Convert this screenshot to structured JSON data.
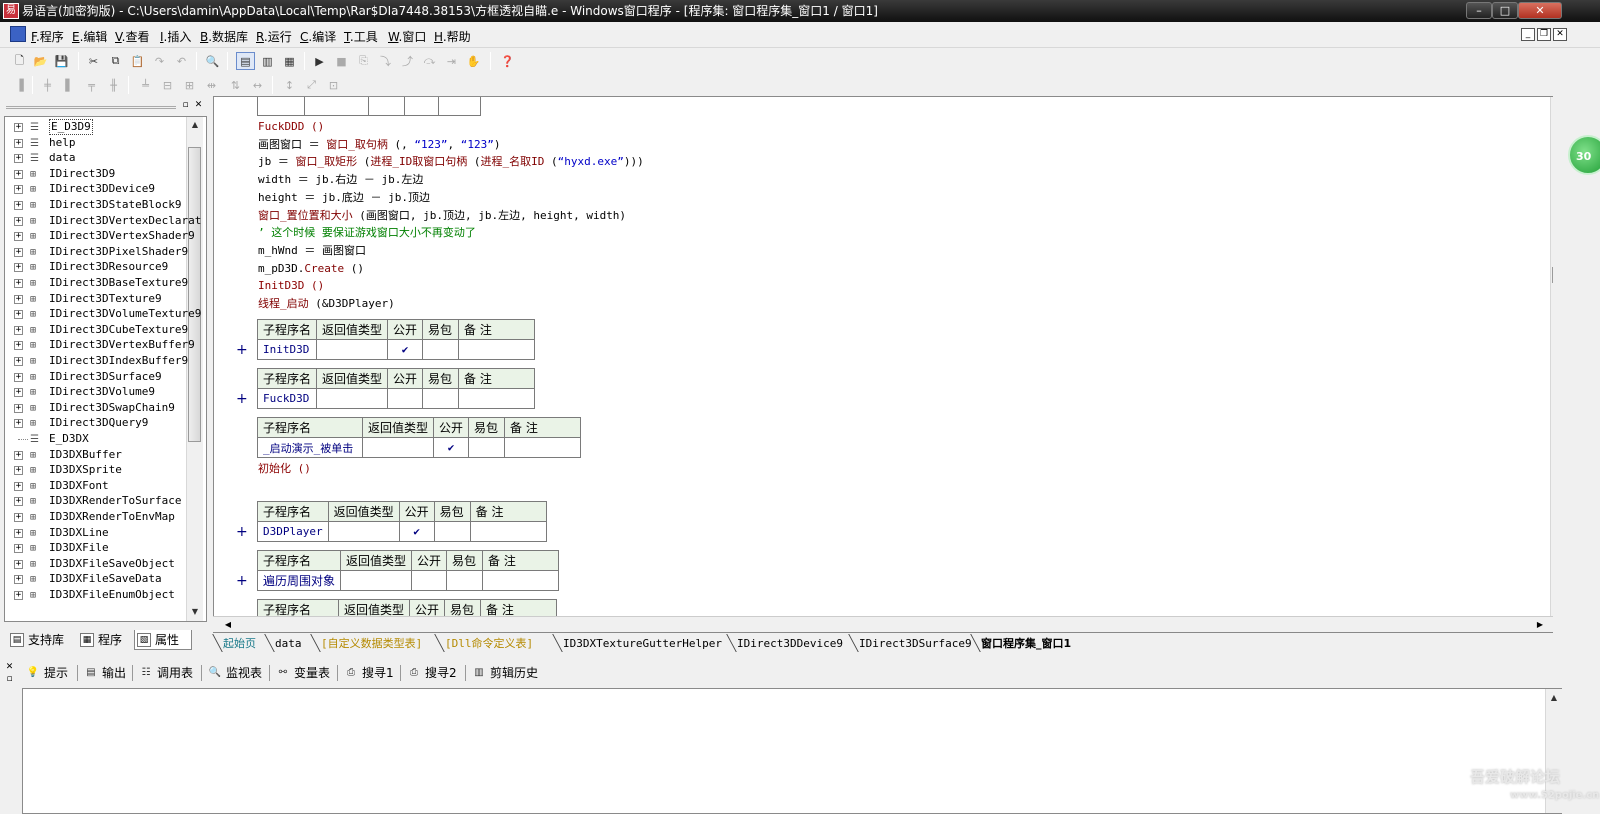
{
  "window": {
    "title": "易语言(加密狗版) - C:\\Users\\damin\\AppData\\Local\\Temp\\Rar$DIa7448.38153\\方框透视自瞄.e - Windows窗口程序 - [程序集: 窗口程序集_窗口1 / 窗口1]",
    "controls": {
      "minimize": "–",
      "maximize": "□",
      "close": "✕"
    }
  },
  "menubar": {
    "items": [
      {
        "key": "F",
        "label": ".程序"
      },
      {
        "key": "E",
        "label": ".编辑"
      },
      {
        "key": "V",
        "label": ".查看"
      },
      {
        "key": "I",
        "label": ".插入"
      },
      {
        "key": "B",
        "label": ".数据库"
      },
      {
        "key": "R",
        "label": ".运行"
      },
      {
        "key": "C",
        "label": ".编译"
      },
      {
        "key": "T",
        "label": ".工具"
      },
      {
        "key": "W",
        "label": ".窗口"
      },
      {
        "key": "H",
        "label": ".帮助"
      }
    ],
    "mdi": {
      "minimize": "_",
      "restore": "❐",
      "close": "✕"
    }
  },
  "toolbar1": {
    "icons": [
      "new-file-icon",
      "open-icon",
      "save-icon",
      "cut-icon",
      "copy-icon",
      "paste-icon",
      "redo-icon",
      "undo-icon",
      "find-icon",
      "layout-1-icon",
      "layout-2-icon",
      "layout-3-icon",
      "run-icon",
      "stop-icon",
      "step-icon",
      "step-into-icon",
      "step-out-icon",
      "step-over-icon",
      "run-to-cursor-icon",
      "hand-icon",
      "help-icon"
    ]
  },
  "toolbar2": {
    "icons": [
      "align-left-icon",
      "align-center-icon",
      "align-right-icon",
      "align-top-icon",
      "align-middle-icon",
      "align-bottom-icon",
      "center-h-icon",
      "center-v-icon",
      "space-h-icon",
      "space-v-icon",
      "same-width-icon",
      "same-height-icon",
      "same-size-icon"
    ]
  },
  "left_panel": {
    "tree": [
      {
        "label": "E_D3D9",
        "icon": "library-icon",
        "expander": "+",
        "selected": true
      },
      {
        "label": "help",
        "icon": "library-icon",
        "expander": "+"
      },
      {
        "label": "data",
        "icon": "library-icon",
        "expander": "+"
      },
      {
        "label": "IDirect3D9",
        "icon": "class-icon",
        "expander": "+"
      },
      {
        "label": "IDirect3DDevice9",
        "icon": "class-icon",
        "expander": "+"
      },
      {
        "label": "IDirect3DStateBlock9",
        "icon": "class-icon",
        "expander": "+"
      },
      {
        "label": "IDirect3DVertexDeclarat",
        "icon": "class-icon",
        "expander": "+"
      },
      {
        "label": "IDirect3DVertexShader9",
        "icon": "class-icon",
        "expander": "+"
      },
      {
        "label": "IDirect3DPixelShader9",
        "icon": "class-icon",
        "expander": "+"
      },
      {
        "label": "IDirect3DResource9",
        "icon": "class-icon",
        "expander": "+"
      },
      {
        "label": "IDirect3DBaseTexture9",
        "icon": "class-icon",
        "expander": "+"
      },
      {
        "label": "IDirect3DTexture9",
        "icon": "class-icon",
        "expander": "+"
      },
      {
        "label": "IDirect3DVolumeTexture9",
        "icon": "class-icon",
        "expander": "+"
      },
      {
        "label": "IDirect3DCubeTexture9",
        "icon": "class-icon",
        "expander": "+"
      },
      {
        "label": "IDirect3DVertexBuffer9",
        "icon": "class-icon",
        "expander": "+"
      },
      {
        "label": "IDirect3DIndexBuffer9",
        "icon": "class-icon",
        "expander": "+"
      },
      {
        "label": "IDirect3DSurface9",
        "icon": "class-icon",
        "expander": "+"
      },
      {
        "label": "IDirect3DVolume9",
        "icon": "class-icon",
        "expander": "+"
      },
      {
        "label": "IDirect3DSwapChain9",
        "icon": "class-icon",
        "expander": "+"
      },
      {
        "label": "IDirect3DQuery9",
        "icon": "class-icon",
        "expander": "+"
      },
      {
        "label": "E_D3DX",
        "icon": "library-icon",
        "expander": ""
      },
      {
        "label": "ID3DXBuffer",
        "icon": "class-icon",
        "expander": "+"
      },
      {
        "label": "ID3DXSprite",
        "icon": "class-icon",
        "expander": "+"
      },
      {
        "label": "ID3DXFont",
        "icon": "class-icon",
        "expander": "+"
      },
      {
        "label": "ID3DXRenderToSurface",
        "icon": "class-icon",
        "expander": "+"
      },
      {
        "label": "ID3DXRenderToEnvMap",
        "icon": "class-icon",
        "expander": "+"
      },
      {
        "label": "ID3DXLine",
        "icon": "class-icon",
        "expander": "+"
      },
      {
        "label": "ID3DXFile",
        "icon": "class-icon",
        "expander": "+"
      },
      {
        "label": "ID3DXFileSaveObject",
        "icon": "class-icon",
        "expander": "+"
      },
      {
        "label": "ID3DXFileSaveData",
        "icon": "class-icon",
        "expander": "+"
      },
      {
        "label": "ID3DXFileEnumObject",
        "icon": "class-icon",
        "expander": "+"
      }
    ],
    "tabs": [
      {
        "label": "支持库",
        "icon": "library-tab-icon",
        "active": false
      },
      {
        "label": "程序",
        "icon": "program-tab-icon",
        "active": false
      },
      {
        "label": "属性",
        "icon": "property-tab-icon",
        "active": true
      }
    ]
  },
  "editor": {
    "code_lines": [
      {
        "row": 0,
        "parts": [
          {
            "t": "FuckDDD ()",
            "c": "c-red"
          }
        ]
      },
      {
        "row": 1,
        "parts": [
          {
            "t": "画图窗口 ＝ ",
            "c": "c-blk"
          },
          {
            "t": "窗口_取句柄",
            "c": "c-call"
          },
          {
            "t": " (, ",
            "c": "c-blk"
          },
          {
            "t": "“123”",
            "c": "c-str"
          },
          {
            "t": ", ",
            "c": "c-blk"
          },
          {
            "t": "“123”",
            "c": "c-str"
          },
          {
            "t": ")",
            "c": "c-blk"
          }
        ]
      },
      {
        "row": 2,
        "parts": [
          {
            "t": "jb ＝ ",
            "c": "c-blk"
          },
          {
            "t": "窗口_取矩形",
            "c": "c-call"
          },
          {
            "t": " (",
            "c": "c-blk"
          },
          {
            "t": "进程_ID取窗口句柄",
            "c": "c-call"
          },
          {
            "t": " (",
            "c": "c-blk"
          },
          {
            "t": "进程_名取ID",
            "c": "c-call"
          },
          {
            "t": " (",
            "c": "c-blk"
          },
          {
            "t": "“hyxd.exe”",
            "c": "c-str"
          },
          {
            "t": ")))",
            "c": "c-blk"
          }
        ]
      },
      {
        "row": 3,
        "parts": [
          {
            "t": "width ＝ jb.右边 － jb.左边",
            "c": "c-blk"
          }
        ]
      },
      {
        "row": 4,
        "parts": [
          {
            "t": "height ＝ jb.底边 － jb.顶边",
            "c": "c-blk"
          }
        ]
      },
      {
        "row": 5,
        "parts": [
          {
            "t": "窗口_置位置和大小",
            "c": "c-call"
          },
          {
            "t": " (画图窗口, jb.顶边, jb.左边, height, width)",
            "c": "c-blk"
          }
        ]
      },
      {
        "row": 6,
        "parts": [
          {
            "t": "’ 这个时候 要保证游戏窗口大小不再变动了",
            "c": "c-cmt"
          }
        ]
      },
      {
        "row": 7,
        "parts": [
          {
            "t": "m_hWnd ＝ 画图窗口",
            "c": "c-blk"
          }
        ]
      },
      {
        "row": 8,
        "parts": [
          {
            "t": "m_pD3D.",
            "c": "c-blk"
          },
          {
            "t": "Create",
            "c": "c-call"
          },
          {
            "t": " ()",
            "c": "c-blk"
          }
        ]
      },
      {
        "row": 9,
        "parts": [
          {
            "t": "InitD3D ()",
            "c": "c-red"
          }
        ]
      },
      {
        "row": 10,
        "parts": [
          {
            "t": "线程_启动",
            "c": "c-call"
          },
          {
            "t": " (&D3DPlayer)",
            "c": "c-blk"
          }
        ]
      }
    ],
    "sub_headers": [
      "子程序名",
      "返回值类型",
      "公开",
      "易包",
      "备 注"
    ],
    "subs": [
      {
        "name": "InitD3D",
        "public": "✔",
        "plus": "+"
      },
      {
        "name": "FuckD3D",
        "public": "",
        "plus": "+"
      },
      {
        "name": "_启动演示_被单击",
        "public": "✔",
        "plus": ""
      },
      {
        "name": "D3DPlayer",
        "public": "✔",
        "plus": "+"
      },
      {
        "name": "遍历周围对象",
        "public": "",
        "plus": "+"
      }
    ],
    "init_line": "初始化 ()"
  },
  "doc_tabs": [
    {
      "label": "起始页",
      "color": "#1a7a8a",
      "selected": false
    },
    {
      "label": "data",
      "color": "#000000",
      "selected": false
    },
    {
      "label": "[自定义数据类型表]",
      "color": "#b58a00",
      "selected": false
    },
    {
      "label": "[Dll命令定义表]",
      "color": "#b58a00",
      "selected": false
    },
    {
      "label": "ID3DXTextureGutterHelper",
      "color": "#000000",
      "selected": false
    },
    {
      "label": "IDirect3DDevice9",
      "color": "#000000",
      "selected": false
    },
    {
      "label": "IDirect3DSurface9",
      "color": "#000000",
      "selected": false
    },
    {
      "label": "窗口程序集_窗口1",
      "color": "#000000",
      "selected": true
    }
  ],
  "output_panel": {
    "tabs": [
      {
        "label": "提示",
        "icon": "tip-icon"
      },
      {
        "label": "输出",
        "icon": "output-icon"
      },
      {
        "label": "调用表",
        "icon": "callstack-icon"
      },
      {
        "label": "监视表",
        "icon": "watch-icon"
      },
      {
        "label": "变量表",
        "icon": "variables-icon"
      },
      {
        "label": "搜寻1",
        "icon": "search1-icon"
      },
      {
        "label": "搜寻2",
        "icon": "search2-icon"
      },
      {
        "label": "剪辑历史",
        "icon": "clip-history-icon"
      }
    ]
  },
  "overlay": {
    "badge": "30",
    "watermark": "吾爱破解论坛",
    "watermark_sub": "www.52pojie.cn"
  }
}
